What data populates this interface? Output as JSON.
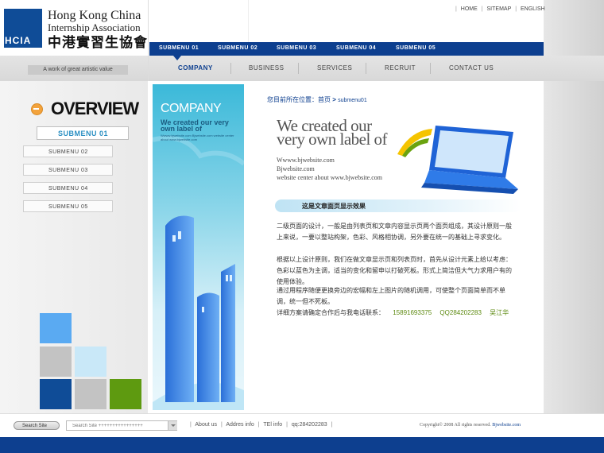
{
  "top_links": [
    "HOME",
    "SITEMAP",
    "ENGLISH"
  ],
  "logo": {
    "abbr": "HCIA",
    "name_en_line1": "Hong Kong China",
    "name_en_line2": "Internship Association",
    "name_cn": "中港實習生協會"
  },
  "tagline": "A work of great artistic value",
  "submenu_bar": [
    "SUBMENU 01",
    "SUBMENU 02",
    "SUBMENU 03",
    "SUBMENU 04",
    "SUBMENU 05"
  ],
  "main_menu": [
    "COMPANY",
    "BUSINESS",
    "SERVICES",
    "RECRUIT",
    "CONTACT US"
  ],
  "main_menu_active": "COMPANY",
  "sidebar": {
    "title": "OVERVIEW",
    "items": [
      "SUBMENU 01",
      "SUBMENU 02",
      "SUBMENU 03",
      "SUBMENU 04",
      "SUBMENU 05"
    ],
    "active": "SUBMENU 01"
  },
  "banner": {
    "title": "COMPANY",
    "subtitle": "We created our very own label of",
    "small": "Wwww.bjwebsite.com Bjwebsite.com website center about www.bjwebsite.com"
  },
  "breadcrumb": {
    "label": "您目前所在位置：首页",
    "arrow": ">",
    "current": "submenu01"
  },
  "hero": {
    "headline_line1": "We created our",
    "headline_line2": "very own label of",
    "line1": "Wwww.bjwebsite.com",
    "line2": "Bjwebsite.com",
    "line3": "website center about www.bjwebsite.com"
  },
  "article": {
    "title": "这是文章面页显示效果",
    "para1": "二级页面的设计，一般是由列表页和文章内容显示页两个面页组成，其设计原则一般上来说，一要以整站构架，色彩、风格相协调，另外要在统一的基础上寻求变化。",
    "para2": "根据以上设计原则，我们在做文章显示页和列表页时，首先从设计元素上给以考虑：色彩以蓝色为主调，适当的变化和留申以打破死板。形式上简洁但大气力求用户有的使用体验。",
    "para3": "通过用程序随便更换旁边的宏幅和左上图片的随机调用，可使整个页面简单而不单调，统一但不死板。",
    "contact_label": "详细方案请确定合作后与我电话联系：",
    "phone": "15891693375",
    "qq": "QQ284202283",
    "name": "吴江华"
  },
  "footer": {
    "search_button": "Search Site",
    "search_placeholder": "Search Site ++++++++++++++++",
    "links": [
      "About us",
      "Addres info",
      "TEl info",
      "qq:284202283"
    ],
    "copyright_prefix": "Copyright© 2008 All rights reserved.",
    "copyright_site": "Bjwebsite.com"
  },
  "colors": {
    "brand_blue": "#0d3f8f",
    "accent_cyan": "#2a8fc2",
    "contact_green": "#5d8a10"
  }
}
